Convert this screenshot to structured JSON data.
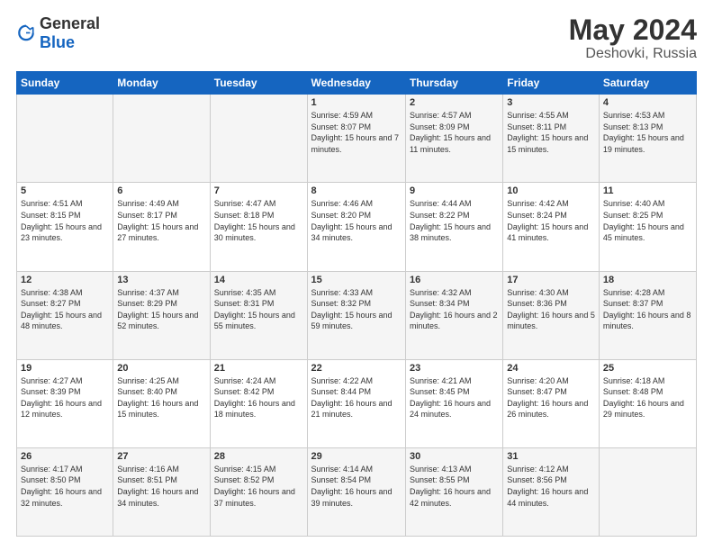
{
  "header": {
    "logo_general": "General",
    "logo_blue": "Blue",
    "month": "May 2024",
    "location": "Deshovki, Russia"
  },
  "weekdays": [
    "Sunday",
    "Monday",
    "Tuesday",
    "Wednesday",
    "Thursday",
    "Friday",
    "Saturday"
  ],
  "weeks": [
    [
      {
        "day": "",
        "sunrise": "",
        "sunset": "",
        "daylight": ""
      },
      {
        "day": "",
        "sunrise": "",
        "sunset": "",
        "daylight": ""
      },
      {
        "day": "",
        "sunrise": "",
        "sunset": "",
        "daylight": ""
      },
      {
        "day": "1",
        "sunrise": "Sunrise: 4:59 AM",
        "sunset": "Sunset: 8:07 PM",
        "daylight": "Daylight: 15 hours and 7 minutes."
      },
      {
        "day": "2",
        "sunrise": "Sunrise: 4:57 AM",
        "sunset": "Sunset: 8:09 PM",
        "daylight": "Daylight: 15 hours and 11 minutes."
      },
      {
        "day": "3",
        "sunrise": "Sunrise: 4:55 AM",
        "sunset": "Sunset: 8:11 PM",
        "daylight": "Daylight: 15 hours and 15 minutes."
      },
      {
        "day": "4",
        "sunrise": "Sunrise: 4:53 AM",
        "sunset": "Sunset: 8:13 PM",
        "daylight": "Daylight: 15 hours and 19 minutes."
      }
    ],
    [
      {
        "day": "5",
        "sunrise": "Sunrise: 4:51 AM",
        "sunset": "Sunset: 8:15 PM",
        "daylight": "Daylight: 15 hours and 23 minutes."
      },
      {
        "day": "6",
        "sunrise": "Sunrise: 4:49 AM",
        "sunset": "Sunset: 8:17 PM",
        "daylight": "Daylight: 15 hours and 27 minutes."
      },
      {
        "day": "7",
        "sunrise": "Sunrise: 4:47 AM",
        "sunset": "Sunset: 8:18 PM",
        "daylight": "Daylight: 15 hours and 30 minutes."
      },
      {
        "day": "8",
        "sunrise": "Sunrise: 4:46 AM",
        "sunset": "Sunset: 8:20 PM",
        "daylight": "Daylight: 15 hours and 34 minutes."
      },
      {
        "day": "9",
        "sunrise": "Sunrise: 4:44 AM",
        "sunset": "Sunset: 8:22 PM",
        "daylight": "Daylight: 15 hours and 38 minutes."
      },
      {
        "day": "10",
        "sunrise": "Sunrise: 4:42 AM",
        "sunset": "Sunset: 8:24 PM",
        "daylight": "Daylight: 15 hours and 41 minutes."
      },
      {
        "day": "11",
        "sunrise": "Sunrise: 4:40 AM",
        "sunset": "Sunset: 8:25 PM",
        "daylight": "Daylight: 15 hours and 45 minutes."
      }
    ],
    [
      {
        "day": "12",
        "sunrise": "Sunrise: 4:38 AM",
        "sunset": "Sunset: 8:27 PM",
        "daylight": "Daylight: 15 hours and 48 minutes."
      },
      {
        "day": "13",
        "sunrise": "Sunrise: 4:37 AM",
        "sunset": "Sunset: 8:29 PM",
        "daylight": "Daylight: 15 hours and 52 minutes."
      },
      {
        "day": "14",
        "sunrise": "Sunrise: 4:35 AM",
        "sunset": "Sunset: 8:31 PM",
        "daylight": "Daylight: 15 hours and 55 minutes."
      },
      {
        "day": "15",
        "sunrise": "Sunrise: 4:33 AM",
        "sunset": "Sunset: 8:32 PM",
        "daylight": "Daylight: 15 hours and 59 minutes."
      },
      {
        "day": "16",
        "sunrise": "Sunrise: 4:32 AM",
        "sunset": "Sunset: 8:34 PM",
        "daylight": "Daylight: 16 hours and 2 minutes."
      },
      {
        "day": "17",
        "sunrise": "Sunrise: 4:30 AM",
        "sunset": "Sunset: 8:36 PM",
        "daylight": "Daylight: 16 hours and 5 minutes."
      },
      {
        "day": "18",
        "sunrise": "Sunrise: 4:28 AM",
        "sunset": "Sunset: 8:37 PM",
        "daylight": "Daylight: 16 hours and 8 minutes."
      }
    ],
    [
      {
        "day": "19",
        "sunrise": "Sunrise: 4:27 AM",
        "sunset": "Sunset: 8:39 PM",
        "daylight": "Daylight: 16 hours and 12 minutes."
      },
      {
        "day": "20",
        "sunrise": "Sunrise: 4:25 AM",
        "sunset": "Sunset: 8:40 PM",
        "daylight": "Daylight: 16 hours and 15 minutes."
      },
      {
        "day": "21",
        "sunrise": "Sunrise: 4:24 AM",
        "sunset": "Sunset: 8:42 PM",
        "daylight": "Daylight: 16 hours and 18 minutes."
      },
      {
        "day": "22",
        "sunrise": "Sunrise: 4:22 AM",
        "sunset": "Sunset: 8:44 PM",
        "daylight": "Daylight: 16 hours and 21 minutes."
      },
      {
        "day": "23",
        "sunrise": "Sunrise: 4:21 AM",
        "sunset": "Sunset: 8:45 PM",
        "daylight": "Daylight: 16 hours and 24 minutes."
      },
      {
        "day": "24",
        "sunrise": "Sunrise: 4:20 AM",
        "sunset": "Sunset: 8:47 PM",
        "daylight": "Daylight: 16 hours and 26 minutes."
      },
      {
        "day": "25",
        "sunrise": "Sunrise: 4:18 AM",
        "sunset": "Sunset: 8:48 PM",
        "daylight": "Daylight: 16 hours and 29 minutes."
      }
    ],
    [
      {
        "day": "26",
        "sunrise": "Sunrise: 4:17 AM",
        "sunset": "Sunset: 8:50 PM",
        "daylight": "Daylight: 16 hours and 32 minutes."
      },
      {
        "day": "27",
        "sunrise": "Sunrise: 4:16 AM",
        "sunset": "Sunset: 8:51 PM",
        "daylight": "Daylight: 16 hours and 34 minutes."
      },
      {
        "day": "28",
        "sunrise": "Sunrise: 4:15 AM",
        "sunset": "Sunset: 8:52 PM",
        "daylight": "Daylight: 16 hours and 37 minutes."
      },
      {
        "day": "29",
        "sunrise": "Sunrise: 4:14 AM",
        "sunset": "Sunset: 8:54 PM",
        "daylight": "Daylight: 16 hours and 39 minutes."
      },
      {
        "day": "30",
        "sunrise": "Sunrise: 4:13 AM",
        "sunset": "Sunset: 8:55 PM",
        "daylight": "Daylight: 16 hours and 42 minutes."
      },
      {
        "day": "31",
        "sunrise": "Sunrise: 4:12 AM",
        "sunset": "Sunset: 8:56 PM",
        "daylight": "Daylight: 16 hours and 44 minutes."
      },
      {
        "day": "",
        "sunrise": "",
        "sunset": "",
        "daylight": ""
      }
    ]
  ]
}
